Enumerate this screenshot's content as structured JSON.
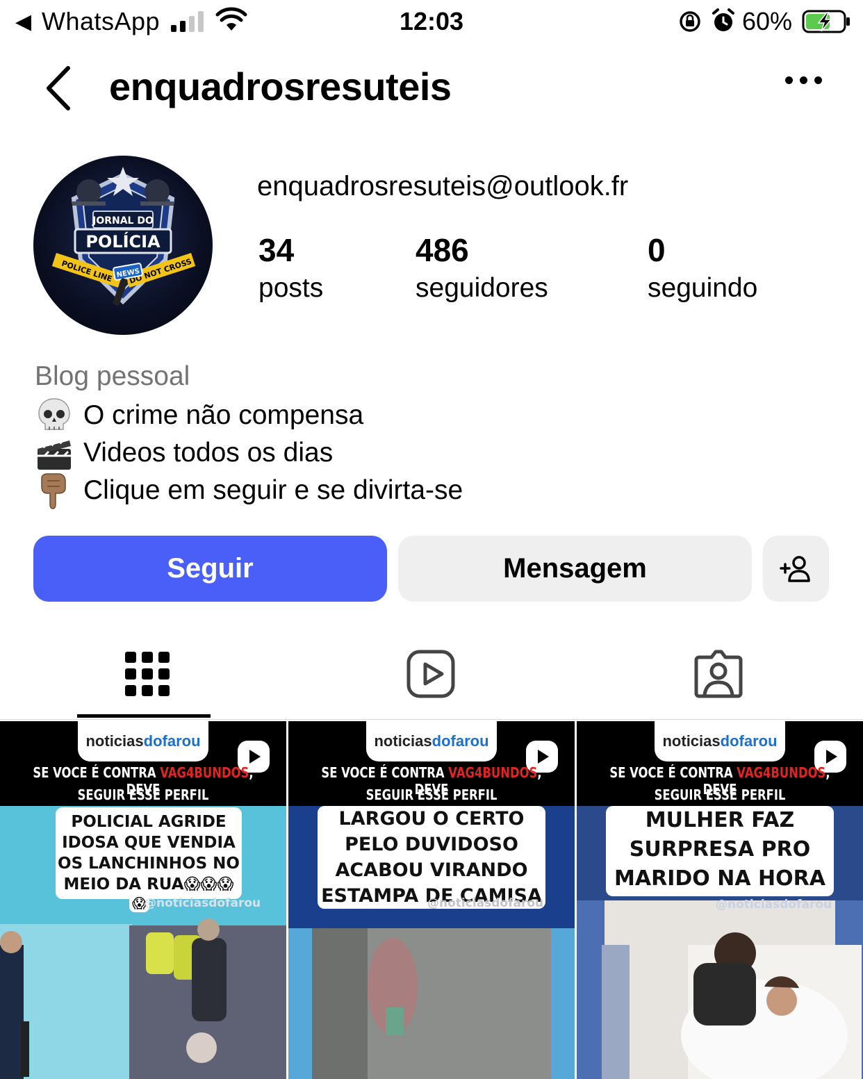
{
  "status_bar": {
    "back_app": "WhatsApp",
    "time": "12:03",
    "battery_percent": "60%",
    "signal_bars_active": 2,
    "signal_bars_total": 4
  },
  "header": {
    "username": "enquadrosresuteis"
  },
  "profile": {
    "avatar_text_1": "JORNAL DO",
    "avatar_text_2": "POLÍCIA",
    "avatar_text_3": "NEWS",
    "avatar_tape_left": "POLICE LINE",
    "avatar_tape_right": "DO NOT CROSS",
    "email": "enquadrosresuteis@outlook.fr",
    "stats": {
      "posts_count": "34",
      "posts_label": "posts",
      "followers_count": "486",
      "followers_label": "seguidores",
      "following_count": "0",
      "following_label": "seguindo"
    },
    "category": "Blog pessoal",
    "bio": [
      {
        "icon": "skull-icon",
        "text": "O crime não compensa"
      },
      {
        "icon": "clapper-board-icon",
        "text": "Videos todos os dias"
      },
      {
        "icon": "pointing-down-icon",
        "text": "Clique em seguir e se divirta-se"
      }
    ]
  },
  "actions": {
    "follow_label": "Seguir",
    "message_label": "Mensagem"
  },
  "tabs": [
    {
      "name": "grid",
      "icon": "grid-icon",
      "active": true
    },
    {
      "name": "reels",
      "icon": "reels-icon",
      "active": false
    },
    {
      "name": "tagged",
      "icon": "tagged-icon",
      "active": false
    }
  ],
  "colors": {
    "follow_button": "#4a5ff7",
    "secondary_button": "#efefef",
    "muted_text": "#737373"
  },
  "posts": [
    {
      "logo_a": "noticias",
      "logo_b": "dofarou",
      "banner_a": "SE VOCE É CONTRA ",
      "banner_red": "VAG4BUNDOS",
      "banner_b": ", DEVE",
      "banner_line2": "SEGUIR ESSE PERFIL",
      "caption_lines": [
        "POLICIAL AGRIDE",
        "IDOSA QUE VENDIA",
        "OS LANCHINHOS NO",
        "MEIO DA RUA😱😱😱",
        "😱"
      ],
      "watermark": "@noticiasdofarou"
    },
    {
      "logo_a": "noticias",
      "logo_b": "dofarou",
      "banner_a": "SE VOCE É CONTRA ",
      "banner_red": "VAG4BUNDOS",
      "banner_b": ", DEVE",
      "banner_line2": "SEGUIR ESSE PERFIL",
      "caption_lines": [
        "LARGOU O CERTO",
        "PELO DUVIDOSO",
        "ACABOU VIRANDO",
        "ESTAMPA DE CAMISA"
      ],
      "watermark": "@noticiasdofarou"
    },
    {
      "logo_a": "noticias",
      "logo_b": "dofarou",
      "banner_a": "SE VOCE É CONTRA ",
      "banner_red": "VAG4BUNDOS",
      "banner_b": ", DEVE",
      "banner_line2": "SEGUIR ESSE PERFIL",
      "caption_lines": [
        "MULHER FAZ",
        "SURPRESA PRO",
        "MARIDO NA HORA"
      ],
      "watermark": "@noticiasdofarou"
    }
  ]
}
